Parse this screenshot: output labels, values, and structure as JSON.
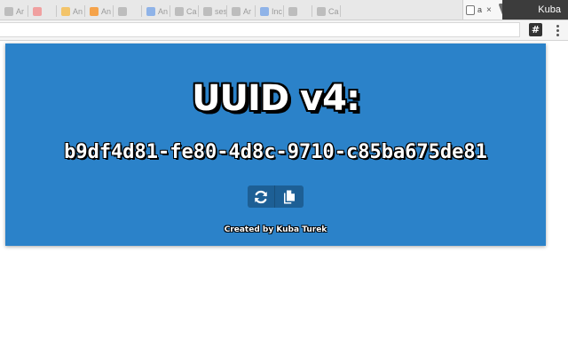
{
  "browser": {
    "profile_name": "Kuba",
    "extension_icon_label": "#",
    "active_tab": {
      "title": "a",
      "close_label": "×"
    },
    "tabs": [
      {
        "title": "Ar"
      },
      {
        "title": ""
      },
      {
        "title": "An"
      },
      {
        "title": "An"
      },
      {
        "title": ""
      },
      {
        "title": "An"
      },
      {
        "title": "Ca"
      },
      {
        "title": "ses"
      },
      {
        "title": "Ar"
      },
      {
        "title": "Inc"
      },
      {
        "title": ""
      },
      {
        "title": "Ca"
      }
    ]
  },
  "popup": {
    "title": "UUID v4:",
    "uuid": "b9df4d81-fe80-4d8c-9710-c85ba675de81",
    "refresh_icon": "refresh-icon",
    "copy_icon": "copy-icon",
    "credit": "Created by Kuba Turek",
    "background_color": "#2b82c9",
    "button_color": "#1d5f95"
  }
}
